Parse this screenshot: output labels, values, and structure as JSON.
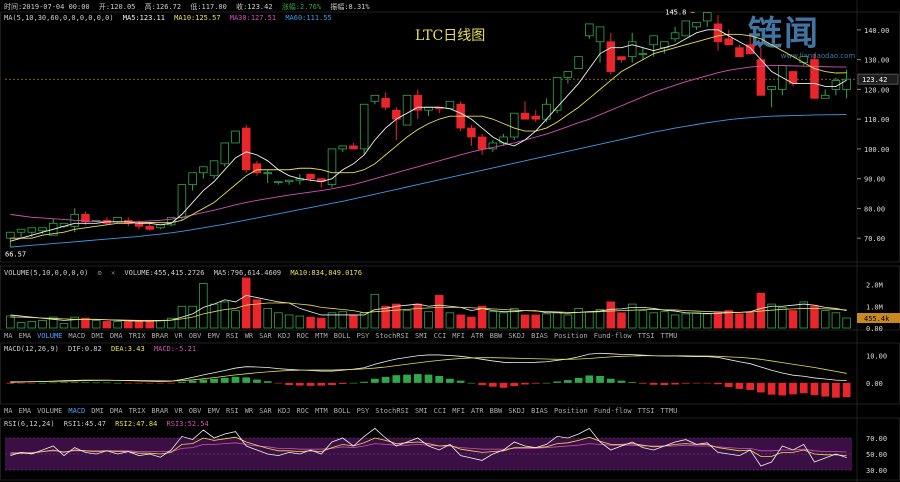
{
  "header": {
    "time": "时间:2019-07-04 00:00",
    "open": "开:120.05",
    "high": "高:126.72",
    "low": "低:117.00",
    "close": "收:123.42",
    "change": "涨幅:2.76%",
    "amplitude": "振幅:8.31%"
  },
  "ma_line": {
    "label": "MA(5,10,30,60,0,0,0,0,0,0)",
    "ma5": "MA5:123.11",
    "ma10": "MA10:125.57",
    "ma30": "MA30:127.51",
    "ma60": "MA60:111.55"
  },
  "volume_line": {
    "label": "VOLUME(5,10,0,0,0,0)",
    "volume": "VOLUME:455,415.2726",
    "ma5": "MA5:796,614.4609",
    "ma10": "MA10:834,849.0176"
  },
  "macd_line": {
    "label": "MACD(12,26,9)",
    "dif": "DIF:0.82",
    "dea": "DEA:3.43",
    "macd": "MACD:-5.21"
  },
  "rsi_line": {
    "label": "RSI(6,12,24)",
    "rsi1": "RSI1:45.47",
    "rsi2": "RSI2:47.84",
    "rsi3": "RSI3:52.54"
  },
  "indicator_tabs": [
    "MA",
    "EMA",
    "VOLUME",
    "MACD",
    "DMI",
    "DMA",
    "TRIX",
    "BRAR",
    "VR",
    "OBV",
    "EMV",
    "RSI",
    "WR",
    "SAR",
    "KDJ",
    "ROC",
    "MTM",
    "BOLL",
    "PSY",
    "StochRSI",
    "SMI",
    "CCI",
    "MFI",
    "ATR",
    "BBW",
    "SKDJ",
    "BIAS",
    "Position",
    "Fund-flow",
    "TTSI",
    "TTMU"
  ],
  "tabs_row1_active": [
    "VOLUME"
  ],
  "tabs_row2_active": [
    "MACD"
  ],
  "logo": {
    "main": "链闻",
    "url": "www.liandaodao.com"
  },
  "chart_data": {
    "type": "candlestick",
    "title": "LTC日线图",
    "price_axis_ticks": [
      "140.00",
      "130.00",
      "120.00",
      "110.00",
      "100.00",
      "90.00",
      "80.00",
      "70.00"
    ],
    "price_range": [
      62,
      146
    ],
    "current_price_label": "123.42",
    "high_annotation": "145.8",
    "low_annotation": "66.57",
    "volume_axis_ticks": [
      "2.0M",
      "1.0M",
      "0.00"
    ],
    "volume_current_label": "455.4k",
    "macd_axis_ticks": [
      "10.00",
      "0.00"
    ],
    "rsi_axis_ticks": [
      "70.00",
      "50.00",
      "30.00"
    ],
    "colors": {
      "up": "#2fa84a",
      "down": "#e8262c",
      "ma5": "#f2f2f2",
      "ma10": "#e8e04a",
      "ma30": "#d64fb8",
      "ma60": "#3b9be6",
      "rsi1": "#f2f2f2",
      "rsi2": "#e8e04a",
      "rsi3": "#d64fb8",
      "rsi_band": "#3a0f44"
    },
    "candles": [
      [
        70,
        72,
        67,
        66.6
      ],
      [
        72,
        73,
        70,
        68
      ],
      [
        72,
        73.5,
        70.5,
        69.5
      ],
      [
        72.5,
        73.5,
        71.5,
        70.5
      ],
      [
        71,
        75,
        71,
        76.5
      ],
      [
        74,
        75,
        73.5,
        72.5
      ],
      [
        74,
        78,
        72,
        80
      ],
      [
        78,
        75.5,
        74.5,
        79
      ],
      [
        76,
        76,
        75.5,
        73.5
      ],
      [
        76,
        75,
        74.5,
        77
      ],
      [
        75.5,
        77,
        75,
        74.5
      ],
      [
        76,
        75,
        74,
        77
      ],
      [
        75,
        74,
        73,
        76
      ],
      [
        74,
        73,
        72.5,
        75
      ],
      [
        73.5,
        74.5,
        73,
        73
      ],
      [
        74.5,
        77,
        74,
        72
      ],
      [
        77,
        88,
        76,
        74
      ],
      [
        88,
        92,
        86,
        85
      ],
      [
        92,
        94,
        90,
        87
      ],
      [
        91,
        96,
        90,
        88
      ],
      [
        95,
        102,
        94,
        92
      ],
      [
        102,
        106,
        102,
        99
      ],
      [
        107,
        93,
        92,
        108
      ],
      [
        95,
        92,
        91,
        96
      ],
      [
        92,
        92,
        88.5,
        93
      ],
      [
        89,
        89,
        88,
        89
      ],
      [
        89,
        89.5,
        88,
        87
      ],
      [
        89.5,
        90,
        88,
        91.5
      ],
      [
        91.5,
        90,
        89,
        87
      ],
      [
        90,
        89,
        87,
        87
      ],
      [
        88,
        100,
        87,
        86
      ],
      [
        100,
        101,
        99,
        93
      ],
      [
        101,
        100,
        100,
        102
      ],
      [
        100,
        115,
        98,
        94
      ],
      [
        116,
        118,
        115,
        102
      ],
      [
        117,
        114,
        113,
        119
      ],
      [
        113,
        110,
        103,
        114
      ],
      [
        108,
        118,
        108,
        106
      ],
      [
        118,
        113,
        110,
        120
      ],
      [
        113,
        114,
        111,
        114
      ],
      [
        114,
        113.5,
        112,
        110
      ],
      [
        113.5,
        116,
        114,
        112
      ],
      [
        115,
        107,
        106,
        116
      ],
      [
        107,
        104,
        101,
        108
      ],
      [
        104,
        100,
        98,
        105
      ],
      [
        100,
        102,
        99,
        103
      ],
      [
        102,
        104,
        101,
        105
      ],
      [
        104,
        112,
        103,
        110
      ],
      [
        112,
        110,
        111,
        116
      ],
      [
        111,
        110,
        109,
        113
      ],
      [
        110,
        115,
        109,
        117
      ],
      [
        113,
        124,
        112,
        116
      ],
      [
        124,
        126,
        122,
        122
      ],
      [
        127,
        131,
        128,
        130
      ],
      [
        138,
        142,
        137,
        135
      ],
      [
        136,
        141,
        129,
        130
      ],
      [
        136,
        126,
        125,
        139
      ],
      [
        131,
        130,
        129,
        127
      ],
      [
        131,
        136,
        129,
        139
      ],
      [
        132,
        132,
        130,
        134
      ],
      [
        135,
        138,
        131,
        130
      ],
      [
        134,
        136,
        132,
        130
      ],
      [
        137,
        139,
        136,
        141
      ],
      [
        138,
        143,
        138,
        142
      ],
      [
        141,
        142.5,
        140,
        139
      ],
      [
        143,
        145.8,
        141,
        140
      ],
      [
        142,
        136,
        133,
        145
      ],
      [
        137,
        135,
        135,
        140
      ],
      [
        134,
        131,
        132,
        135
      ],
      [
        135,
        132,
        133,
        138
      ],
      [
        130,
        118,
        120,
        134
      ],
      [
        120,
        121,
        114,
        121
      ],
      [
        120,
        128,
        118,
        122
      ],
      [
        126,
        122,
        121,
        124
      ],
      [
        129,
        131,
        128,
        126
      ],
      [
        130,
        117,
        121,
        132
      ],
      [
        117,
        118,
        122,
        120
      ],
      [
        120,
        123,
        118,
        124
      ],
      [
        120,
        123.42,
        117,
        126.72
      ]
    ],
    "ma5": [
      69,
      70,
      71,
      72,
      73,
      74,
      75,
      75,
      75,
      75.5,
      75.5,
      75.5,
      75,
      75,
      74.5,
      75,
      78,
      82,
      86,
      89,
      93,
      97,
      99,
      98,
      96,
      93,
      91,
      90,
      89.5,
      89,
      90,
      93,
      95,
      98,
      103,
      107,
      110,
      112,
      114,
      114,
      114,
      113.5,
      112,
      110,
      107,
      104,
      102,
      101,
      103,
      106,
      110,
      114,
      118,
      122,
      127,
      132,
      134,
      134,
      135,
      134,
      133,
      134,
      135,
      137,
      139,
      140,
      140,
      138,
      136,
      134,
      130,
      126,
      124,
      122,
      122,
      122,
      121,
      121,
      123.11
    ],
    "ma10": [
      70,
      70,
      70,
      71,
      71.5,
      72,
      73,
      73.5,
      74,
      74.5,
      75,
      75,
      75.2,
      75.3,
      75.2,
      75.2,
      76,
      78,
      80,
      82,
      85,
      88,
      91,
      93,
      93,
      93,
      93,
      93.5,
      93.5,
      93,
      92,
      92,
      92,
      93,
      95,
      98,
      101,
      104,
      106.5,
      108.5,
      110,
      111,
      111,
      111,
      111,
      110,
      108.5,
      107,
      106,
      106,
      107,
      109,
      111.5,
      114,
      117,
      120,
      123,
      126,
      128,
      130,
      132,
      133,
      134,
      135,
      136,
      137,
      138,
      138.5,
      138.5,
      138,
      137,
      135,
      133,
      131,
      129,
      127,
      126,
      125.5,
      125.57
    ],
    "ma30": [
      78,
      77.5,
      77,
      76.8,
      76.5,
      76.3,
      76,
      75.8,
      75.6,
      75.5,
      75.5,
      75.5,
      75.6,
      75.8,
      76,
      76.4,
      77,
      77.8,
      78.6,
      79.4,
      80.3,
      81.2,
      82,
      82.7,
      83.3,
      83.9,
      84.5,
      85,
      85.5,
      86,
      86.6,
      87.3,
      88,
      89,
      90,
      91,
      92,
      93,
      94,
      95,
      96,
      97,
      98,
      99,
      99.8,
      100.5,
      101.3,
      102,
      103,
      104,
      105,
      106.2,
      107.5,
      108.8,
      110,
      111.5,
      113,
      114.5,
      116,
      117.5,
      119,
      120.2,
      121.4,
      122.6,
      123.6,
      124.6,
      125.6,
      126.4,
      127,
      127.5,
      127.8,
      128,
      128,
      127.9,
      127.8,
      127.7,
      127.6,
      127.55,
      127.51
    ],
    "ma60": [
      67,
      67.3,
      67.6,
      67.9,
      68.2,
      68.5,
      68.8,
      69.1,
      69.4,
      69.7,
      70,
      70.3,
      70.6,
      71,
      71.4,
      71.8,
      72.3,
      72.9,
      73.5,
      74.1,
      74.7,
      75.4,
      76.1,
      76.8,
      77.5,
      78.2,
      78.9,
      79.6,
      80.3,
      81,
      81.7,
      82.4,
      83.2,
      84,
      84.8,
      85.6,
      86.4,
      87.2,
      88,
      88.8,
      89.6,
      90.4,
      91.2,
      92,
      92.8,
      93.6,
      94.4,
      95.2,
      96,
      96.8,
      97.6,
      98.4,
      99.2,
      100,
      100.8,
      101.6,
      102.4,
      103.2,
      104,
      104.8,
      105.6,
      106.3,
      107,
      107.6,
      108.2,
      108.8,
      109.3,
      109.8,
      110.2,
      110.5,
      110.8,
      111,
      111.1,
      111.2,
      111.3,
      111.4,
      111.45,
      111.5,
      111.55
    ],
    "volumes": [
      0.55,
      0.25,
      0.3,
      0.35,
      0.5,
      0.2,
      0.5,
      0.45,
      0.35,
      0.3,
      0.3,
      0.3,
      0.35,
      0.3,
      0.35,
      0.45,
      1.0,
      1.0,
      2.05,
      1.1,
      1.2,
      0.8,
      2.3,
      1.3,
      0.9,
      0.7,
      0.6,
      0.55,
      0.5,
      0.45,
      0.7,
      0.75,
      0.6,
      0.7,
      1.55,
      1.0,
      1.1,
      0.8,
      1.1,
      0.75,
      1.5,
      0.7,
      0.6,
      0.5,
      1.0,
      0.75,
      0.7,
      0.9,
      0.6,
      0.6,
      0.65,
      0.7,
      0.6,
      0.9,
      0.75,
      0.85,
      1.2,
      0.7,
      1.1,
      0.8,
      0.7,
      0.75,
      0.6,
      0.65,
      0.7,
      0.65,
      0.7,
      0.8,
      0.65,
      0.7,
      1.6,
      1.1,
      0.95,
      0.8,
      1.2,
      1.0,
      0.8,
      0.7,
      0.46
    ],
    "vol_ma5": [
      0.6,
      0.55,
      0.5,
      0.45,
      0.4,
      0.35,
      0.38,
      0.4,
      0.4,
      0.38,
      0.35,
      0.33,
      0.32,
      0.32,
      0.33,
      0.36,
      0.5,
      0.65,
      0.95,
      1.1,
      1.3,
      1.2,
      1.5,
      1.4,
      1.3,
      1.2,
      1.15,
      0.9,
      0.75,
      0.6,
      0.6,
      0.6,
      0.6,
      0.6,
      0.85,
      0.9,
      1.0,
      1.05,
      1.1,
      1.0,
      1.05,
      1.0,
      0.95,
      0.8,
      0.9,
      0.8,
      0.75,
      0.75,
      0.8,
      0.8,
      0.7,
      0.7,
      0.68,
      0.72,
      0.75,
      0.78,
      0.86,
      0.88,
      0.95,
      0.95,
      0.9,
      0.82,
      0.78,
      0.7,
      0.68,
      0.67,
      0.68,
      0.7,
      0.72,
      0.75,
      0.9,
      1.0,
      1.0,
      1.05,
      1.1,
      1.05,
      0.95,
      0.9,
      0.8
    ],
    "vol_ma10": [
      0.5,
      0.5,
      0.48,
      0.46,
      0.44,
      0.42,
      0.4,
      0.4,
      0.39,
      0.38,
      0.37,
      0.36,
      0.35,
      0.35,
      0.35,
      0.36,
      0.42,
      0.5,
      0.65,
      0.75,
      0.85,
      0.9,
      1.05,
      1.1,
      1.15,
      1.15,
      1.15,
      1.1,
      1.05,
      0.95,
      0.9,
      0.85,
      0.8,
      0.7,
      0.75,
      0.78,
      0.82,
      0.85,
      0.9,
      0.92,
      0.95,
      0.95,
      0.95,
      0.93,
      0.9,
      0.88,
      0.85,
      0.82,
      0.8,
      0.78,
      0.76,
      0.74,
      0.72,
      0.72,
      0.73,
      0.75,
      0.78,
      0.8,
      0.82,
      0.84,
      0.85,
      0.84,
      0.83,
      0.8,
      0.78,
      0.76,
      0.74,
      0.73,
      0.72,
      0.73,
      0.78,
      0.82,
      0.86,
      0.88,
      0.9,
      0.9,
      0.88,
      0.86,
      0.83
    ],
    "macd_hist": [
      -0.3,
      -0.2,
      -0.1,
      0,
      0.1,
      0.2,
      0.2,
      0.2,
      0.1,
      0.1,
      0,
      -0.1,
      -0.1,
      -0.2,
      -0.2,
      -0.1,
      0.4,
      0.8,
      1.2,
      1.5,
      1.8,
      2.2,
      2.0,
      1.2,
      0.6,
      -0.2,
      -0.8,
      -1.0,
      -1.1,
      -1.0,
      -0.8,
      -0.4,
      0,
      0.4,
      1.5,
      2.2,
      2.8,
      3.0,
      3.2,
      3.0,
      2.5,
      1.5,
      0.8,
      0,
      -0.8,
      -1.4,
      -1.8,
      -1.2,
      -0.6,
      -0.3,
      0,
      0.5,
      1.0,
      1.8,
      2.7,
      2.5,
      1.5,
      0.8,
      0.3,
      -0.3,
      -0.7,
      -0.8,
      -0.6,
      -0.3,
      -0.2,
      -0.1,
      -0.5,
      -1.5,
      -2.2,
      -2.6,
      -3.5,
      -4.3,
      -4.6,
      -4.2,
      -3.8,
      -4.5,
      -5.0,
      -5.4,
      -5.21
    ],
    "macd_dif": [
      0.2,
      0.3,
      0.4,
      0.5,
      0.6,
      0.8,
      0.9,
      1.0,
      1.0,
      1.0,
      0.9,
      0.8,
      0.7,
      0.6,
      0.5,
      0.6,
      1.2,
      2.0,
      2.9,
      3.7,
      4.5,
      5.4,
      5.9,
      5.8,
      5.6,
      5.2,
      4.9,
      4.7,
      4.5,
      4.3,
      4.3,
      4.6,
      5.0,
      5.5,
      6.8,
      7.8,
      8.7,
      9.3,
      9.9,
      10.2,
      10.2,
      10.0,
      9.7,
      9.2,
      8.6,
      8.0,
      7.5,
      7.4,
      7.4,
      7.5,
      7.7,
      8.2,
      8.7,
      9.5,
      10.5,
      10.8,
      10.6,
      10.4,
      10.3,
      10.1,
      9.9,
      9.8,
      9.8,
      9.7,
      9.6,
      9.6,
      9.3,
      8.5,
      7.7,
      7.0,
      5.8,
      4.6,
      3.6,
      2.8,
      2.4,
      1.8,
      1.4,
      1.0,
      0.82
    ],
    "macd_dea": [
      0.4,
      0.4,
      0.45,
      0.5,
      0.55,
      0.6,
      0.7,
      0.8,
      0.85,
      0.9,
      0.9,
      0.9,
      0.85,
      0.8,
      0.75,
      0.7,
      0.8,
      1.1,
      1.5,
      1.9,
      2.4,
      2.9,
      3.3,
      3.7,
      4.0,
      4.3,
      4.5,
      4.6,
      4.7,
      4.7,
      4.7,
      4.8,
      4.9,
      5.1,
      5.4,
      5.8,
      6.3,
      6.8,
      7.3,
      7.8,
      8.2,
      8.6,
      8.9,
      9.1,
      9.2,
      9.2,
      9.1,
      9.0,
      8.9,
      8.8,
      8.7,
      8.6,
      8.6,
      8.7,
      8.9,
      9.2,
      9.5,
      9.7,
      9.8,
      9.9,
      9.9,
      9.9,
      9.9,
      9.9,
      9.8,
      9.8,
      9.7,
      9.5,
      9.3,
      9.0,
      8.6,
      8.0,
      7.4,
      6.8,
      6.2,
      5.6,
      4.9,
      4.2,
      3.43
    ],
    "rsi1": [
      48,
      52,
      50,
      55,
      60,
      48,
      58,
      52,
      50,
      54,
      50,
      53,
      48,
      50,
      46,
      55,
      72,
      68,
      80,
      70,
      75,
      78,
      60,
      55,
      50,
      48,
      52,
      50,
      55,
      50,
      65,
      70,
      60,
      72,
      82,
      70,
      60,
      65,
      70,
      60,
      55,
      62,
      48,
      45,
      42,
      50,
      55,
      65,
      60,
      58,
      62,
      72,
      70,
      75,
      82,
      65,
      55,
      60,
      65,
      58,
      55,
      60,
      65,
      68,
      62,
      64,
      52,
      50,
      48,
      55,
      35,
      40,
      60,
      55,
      62,
      40,
      45,
      50,
      45.47
    ],
    "rsi2": [
      50,
      51,
      51,
      53,
      55,
      52,
      55,
      54,
      53,
      54,
      53,
      53,
      51,
      51,
      50,
      52,
      62,
      63,
      70,
      67,
      69,
      71,
      65,
      61,
      57,
      54,
      54,
      53,
      54,
      53,
      58,
      62,
      60,
      64,
      70,
      67,
      63,
      64,
      65,
      63,
      60,
      61,
      56,
      54,
      52,
      53,
      54,
      58,
      58,
      58,
      59,
      63,
      64,
      67,
      71,
      66,
      62,
      62,
      63,
      61,
      59,
      60,
      62,
      63,
      62,
      62,
      58,
      56,
      54,
      55,
      47,
      47,
      52,
      52,
      55,
      50,
      49,
      49,
      47.84
    ],
    "rsi3": [
      52,
      52,
      52,
      53,
      54,
      53,
      54,
      54,
      54,
      54,
      54,
      54,
      53,
      53,
      53,
      53,
      57,
      58,
      62,
      62,
      63,
      64,
      62,
      60,
      59,
      57,
      57,
      56,
      56,
      56,
      57,
      59,
      58,
      60,
      63,
      62,
      61,
      61,
      62,
      61,
      60,
      60,
      58,
      57,
      56,
      56,
      56,
      57,
      57,
      57,
      58,
      59,
      60,
      61,
      63,
      62,
      61,
      61,
      61,
      60,
      60,
      60,
      60,
      61,
      60,
      60,
      59,
      58,
      57,
      57,
      54,
      54,
      55,
      55,
      56,
      54,
      53,
      53,
      52.54
    ]
  }
}
